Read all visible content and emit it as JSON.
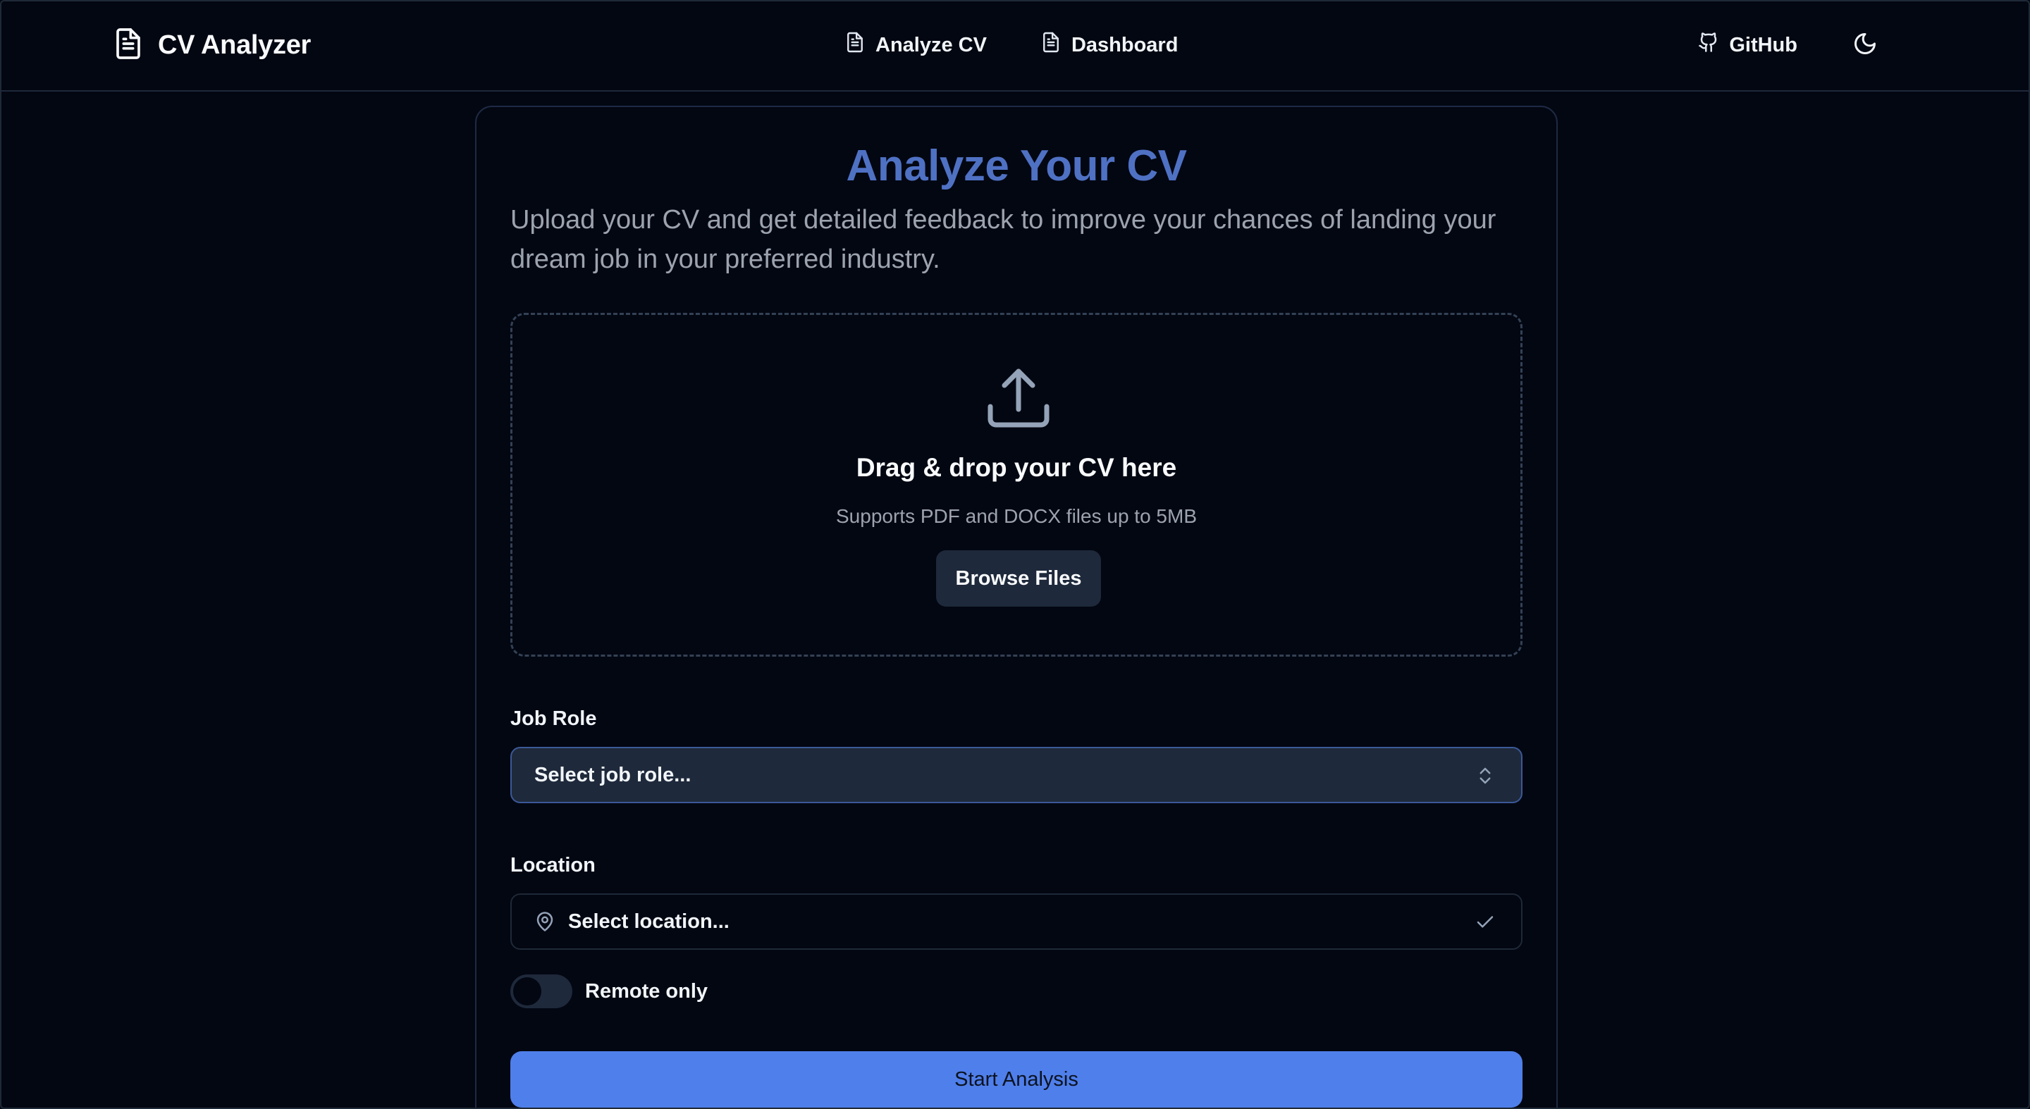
{
  "header": {
    "brand": "CV Analyzer",
    "nav": [
      {
        "label": "Analyze CV",
        "icon": "file-text-icon"
      },
      {
        "label": "Dashboard",
        "icon": "file-text-icon"
      }
    ],
    "github": "GitHub",
    "theme_icon": "moon-icon"
  },
  "card": {
    "title": "Analyze Your CV",
    "description": "Upload your CV and get detailed feedback to improve your chances of landing your dream job in your preferred industry."
  },
  "upload": {
    "icon": "upload-icon",
    "title": "Drag & drop your CV here",
    "subtitle": "Supports PDF and DOCX files up to 5MB",
    "browse_label": "Browse Files"
  },
  "form": {
    "job_role_label": "Job Role",
    "job_role_placeholder": "Select job role...",
    "location_label": "Location",
    "location_placeholder": "Select location...",
    "remote_label": "Remote only",
    "remote_only": false,
    "submit_label": "Start Analysis"
  },
  "colors": {
    "background": "#030712",
    "accent": "#4f7fea",
    "title": "#4f71c4",
    "muted_text": "#9ca3af"
  }
}
